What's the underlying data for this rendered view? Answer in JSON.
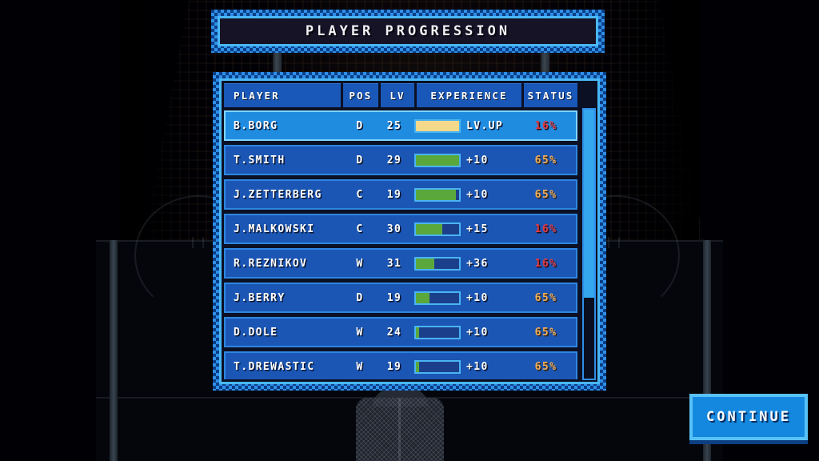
{
  "title": {
    "text": "PLAYER PROGRESSION"
  },
  "table": {
    "columns": [
      "PLAYER",
      "POS",
      "LV",
      "EXPERIENCE",
      "STATUS"
    ],
    "rows": [
      {
        "player": "B.BORG",
        "pos": "D",
        "lv": "25",
        "xp_percent": 100,
        "xp_color": "#f5d98a",
        "delta": "LV.UP",
        "status": "16%",
        "status_tone": "red",
        "selected": true
      },
      {
        "player": "T.SMITH",
        "pos": "D",
        "lv": "29",
        "xp_percent": 100,
        "xp_color": "#5aa83c",
        "delta": "+10",
        "status": "65%",
        "status_tone": "gold",
        "selected": false
      },
      {
        "player": "J.ZETTERBERG",
        "pos": "C",
        "lv": "19",
        "xp_percent": 92,
        "xp_color": "#5aa83c",
        "delta": "+10",
        "status": "65%",
        "status_tone": "gold",
        "selected": false
      },
      {
        "player": "J.MALKOWSKI",
        "pos": "C",
        "lv": "30",
        "xp_percent": 62,
        "xp_color": "#5aa83c",
        "delta": "+15",
        "status": "16%",
        "status_tone": "red",
        "selected": false
      },
      {
        "player": "R.REZNIKOV",
        "pos": "W",
        "lv": "31",
        "xp_percent": 42,
        "xp_color": "#5aa83c",
        "delta": "+36",
        "status": "16%",
        "status_tone": "red",
        "selected": false
      },
      {
        "player": "J.BERRY",
        "pos": "D",
        "lv": "19",
        "xp_percent": 32,
        "xp_color": "#5aa83c",
        "delta": "+10",
        "status": "65%",
        "status_tone": "gold",
        "selected": false
      },
      {
        "player": "D.DOLE",
        "pos": "W",
        "lv": "24",
        "xp_percent": 7,
        "xp_color": "#5aa83c",
        "delta": "+10",
        "status": "65%",
        "status_tone": "gold",
        "selected": false
      },
      {
        "player": "T.DREWASTIC",
        "pos": "W",
        "lv": "19",
        "xp_percent": 8,
        "xp_color": "#5aa83c",
        "delta": "+10",
        "status": "65%",
        "status_tone": "gold",
        "selected": false
      }
    ],
    "scroll": {
      "thumb_percent": 70
    }
  },
  "continue_button": {
    "label": "CONTINUE"
  },
  "colors": {
    "frame_bright": "#2f8fe8",
    "frame_dark": "#0a3f86",
    "bevel": "#49b7f5",
    "row": "#1b56b4",
    "row_selected": "#1f8ce0",
    "status_red": "#e03a42",
    "status_gold": "#f0ae5a",
    "xp_green": "#5aa83c",
    "xp_yellow": "#f5d98a"
  }
}
